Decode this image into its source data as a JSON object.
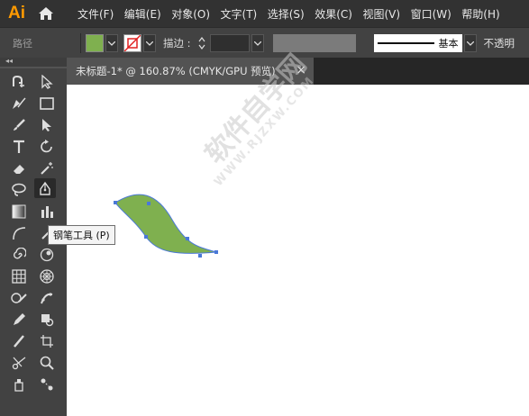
{
  "app": {
    "logo": "Ai"
  },
  "menubar": {
    "items": [
      "文件(F)",
      "编辑(E)",
      "对象(O)",
      "文字(T)",
      "选择(S)",
      "效果(C)",
      "视图(V)",
      "窗口(W)",
      "帮助(H)"
    ]
  },
  "control_bar": {
    "selection_label": "路径",
    "fill_color": "#7fb04f",
    "stroke_label": "描边 :",
    "profile_label": "基本",
    "opacity_label": "不透明"
  },
  "document": {
    "tab_title": "未标题-1* @ 160.87% (CMYK/GPU 预览)",
    "close_glyph": "×"
  },
  "toolbar": {
    "collapse_glyph": "◂◂"
  },
  "tooltip": {
    "text": "钢笔工具 (P)"
  },
  "watermark": {
    "text": "软件自学网",
    "sub": "WWW.RJZXW.COM"
  },
  "shape": {
    "fill": "#7fb04f",
    "anchor_color": "#4a78d8"
  }
}
